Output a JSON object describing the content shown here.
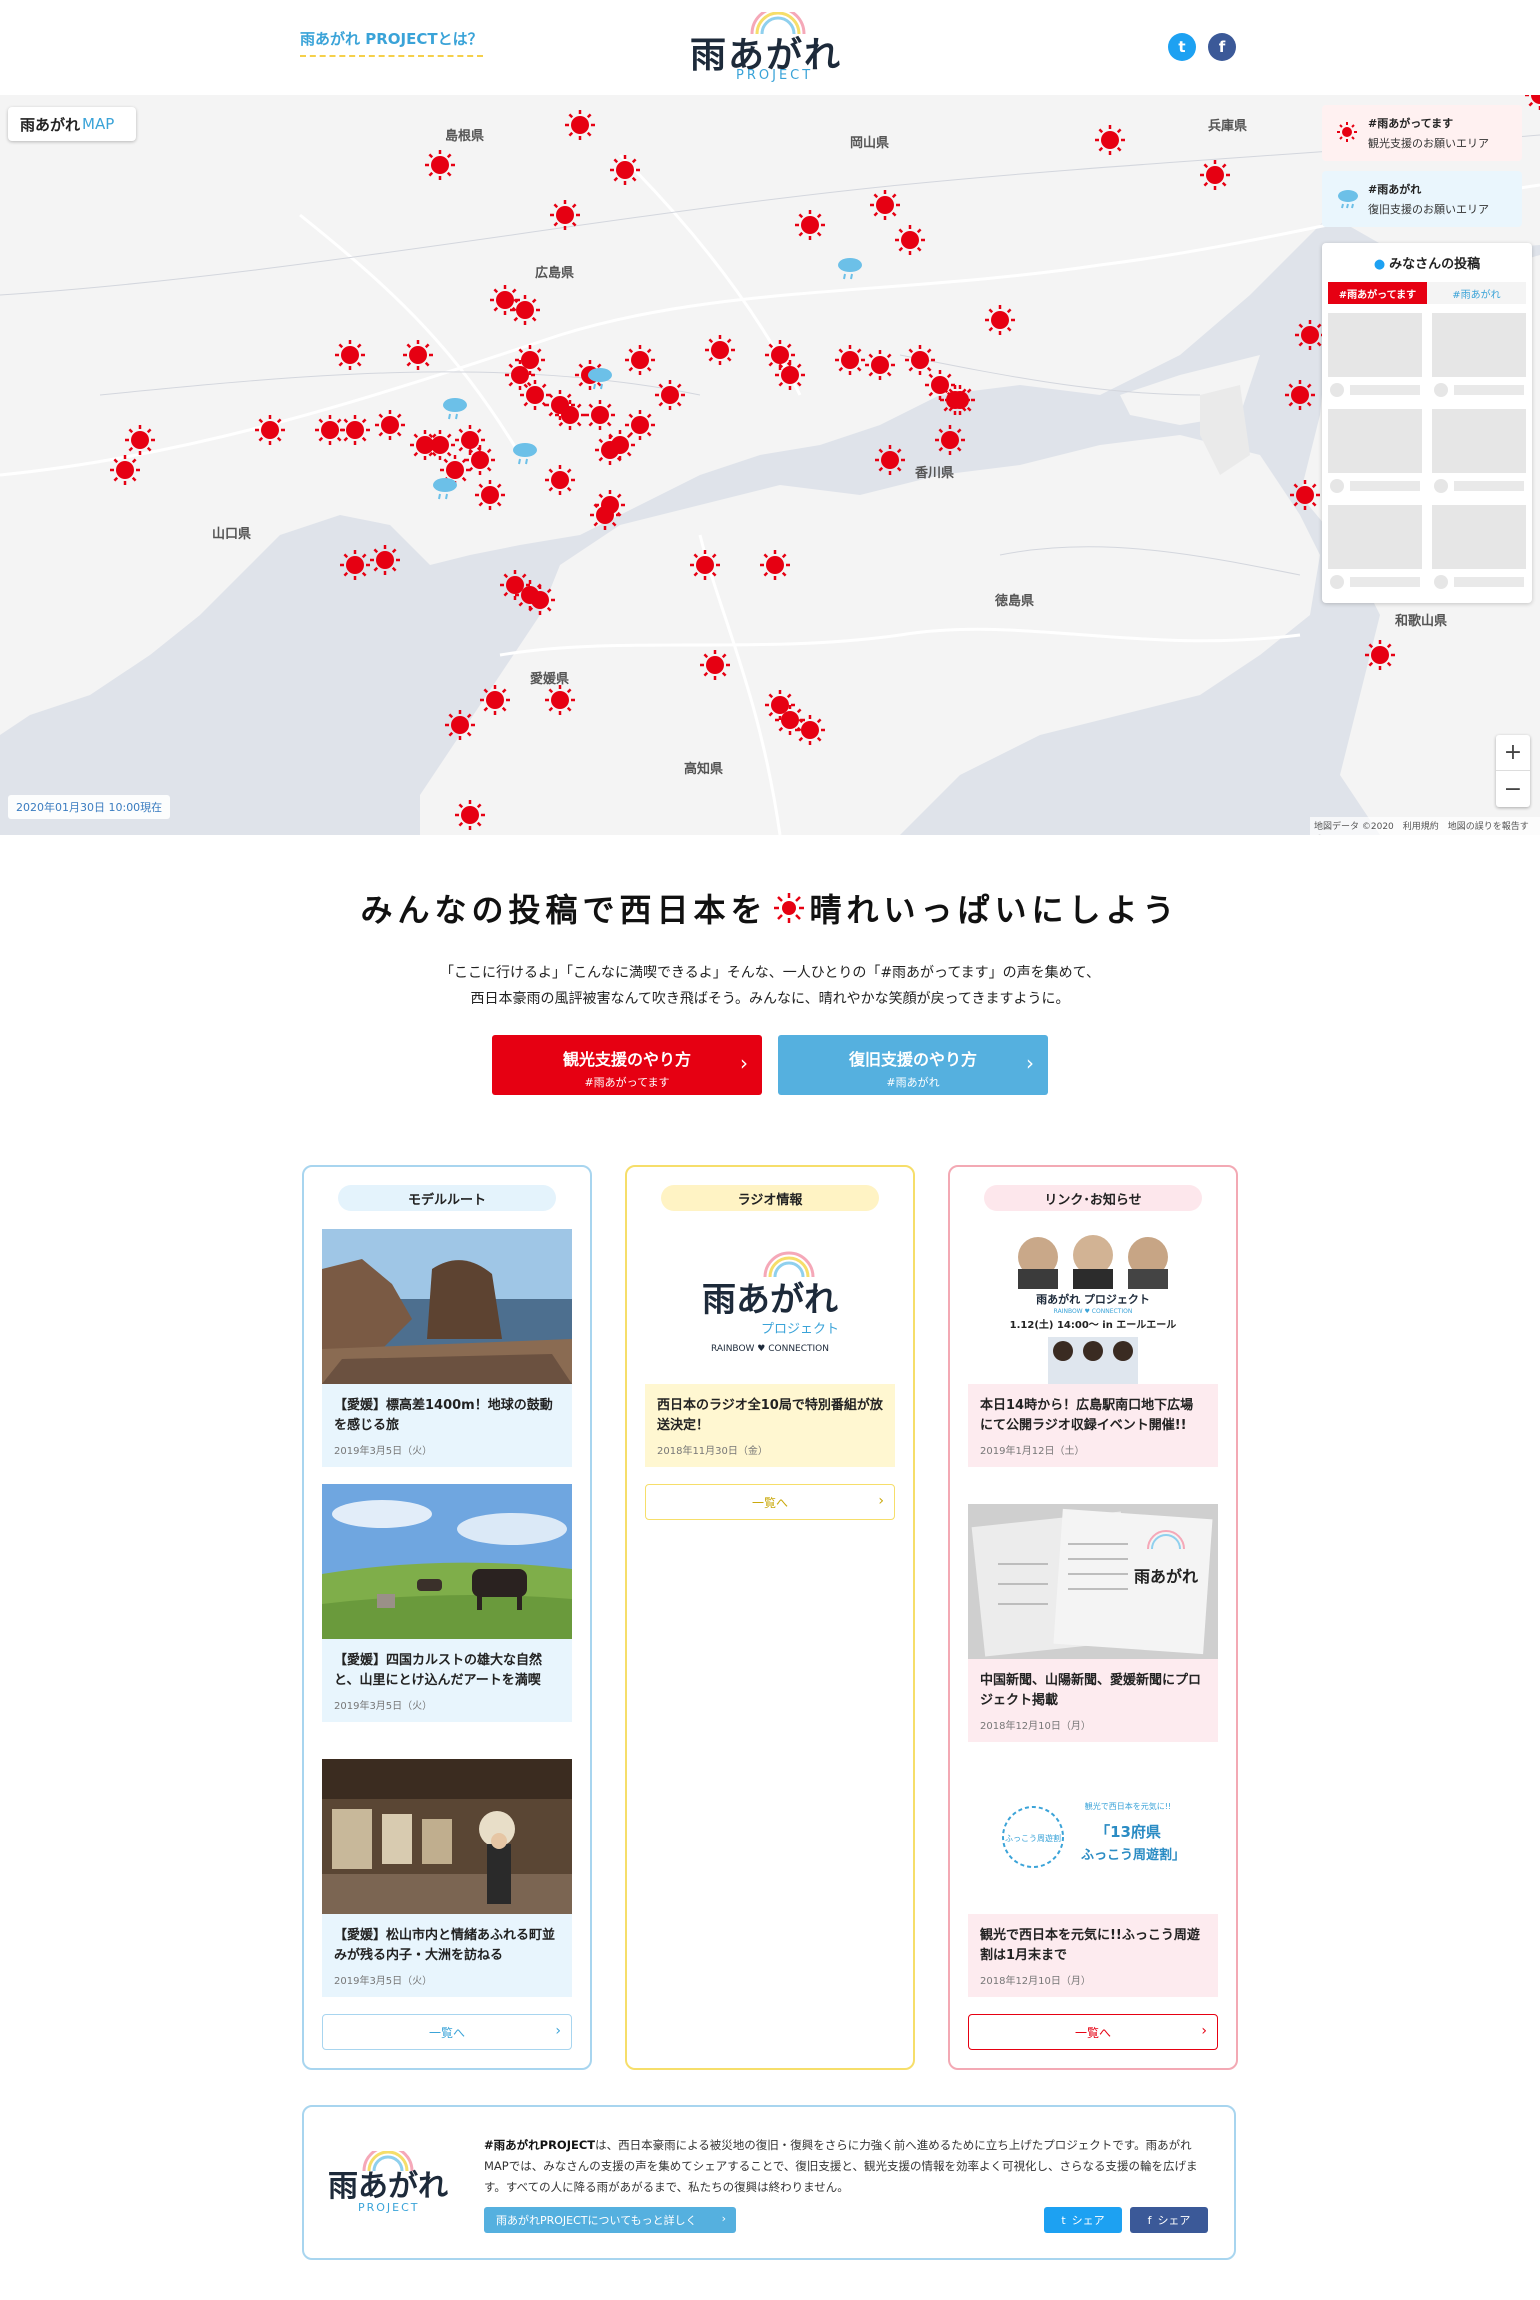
{
  "header": {
    "about_link": "雨あがれ PROJECTとは？",
    "logo_main": "雨あがれ",
    "logo_sub": "PROJECT",
    "twitter_icon": "twitter-icon",
    "facebook_icon": "facebook-icon"
  },
  "map": {
    "badge_main": "雨あがれ",
    "badge_sub": "MAP",
    "date": "2020年01月30日 10:00現在",
    "credit": "地図データ ©2020　利用規約　地図の誤りを報告する",
    "zoom_in": "+",
    "zoom_out": "−",
    "legend_sun_title": "#雨あがってます",
    "legend_sun_desc": "観光支援のお願いエリア",
    "legend_rain_title": "#雨あがれ",
    "legend_rain_desc": "復旧支援のお願いエリア",
    "posts_title": "みなさんの投稿",
    "posts_tab_1": "#雨あがってます",
    "posts_tab_2": "#雨あがれ",
    "prefectures": [
      "島根県",
      "岡山県",
      "兵庫県",
      "広島県",
      "山口県",
      "香川県",
      "徳島県",
      "愛媛県",
      "高知県",
      "和歌山県"
    ],
    "colors": {
      "sun": "#e60012",
      "rain": "#6cc0e8",
      "land": "#f4f4f4",
      "sea": "#dfe3ea"
    }
  },
  "hero": {
    "title_1": "みんなの投稿で西日本を",
    "title_2": "晴れいっぱいにしよう",
    "desc_line1": "「ここに行けるよ」「こんなに満喫できるよ」そんな、一人ひとりの「#雨あがってます」の声を集めて、",
    "desc_line2": "西日本豪雨の風評被害なんて吹き飛ばそう。みんなに、晴れやかな笑顔が戻ってきますように。",
    "cta_tourism_label": "観光支援のやり方",
    "cta_tourism_tag": "#雨あがってます",
    "cta_recovery_label": "復旧支援のやり方",
    "cta_recovery_tag": "#雨あがれ"
  },
  "columns": {
    "model_route": {
      "heading": "モデルルート",
      "cards": [
        {
          "title": "【愛媛】標高差1400m！地球の鼓動を感じる旅",
          "date": "2019年3月5日（火）"
        },
        {
          "title": "【愛媛】四国カルストの雄大な自然と、山里にとけ込んだアートを満喫",
          "date": "2019年3月5日（火）"
        },
        {
          "title": "【愛媛】松山市内と情緒あふれる町並みが残る内子・大洲を訪ねる",
          "date": "2019年3月5日（火）"
        }
      ],
      "more": "一覧へ"
    },
    "radio": {
      "heading": "ラジオ情報",
      "logo_main": "雨あがれ",
      "logo_project": "プロジェクト",
      "logo_sub": "RAINBOW ♥ CONNECTION",
      "cards": [
        {
          "title": "西日本のラジオ全10局で特別番組が放送決定！",
          "date": "2018年11月30日（金）"
        }
      ],
      "more": "一覧へ"
    },
    "news": {
      "heading": "リンク･お知らせ",
      "event_logo": "雨あがれ プロジェクト",
      "event_sub": "RAINBOW ♥ CONNECTION",
      "event_date": "1.12(土) 14:00〜 in エールエール",
      "news_logo": "雨あがれ",
      "fukko_badge": "ふっこう周遊割",
      "fukko_lead": "観光で西日本を元気に!!",
      "fukko_title_1": "「13府県",
      "fukko_title_2": "ふっこう周遊割」",
      "cards": [
        {
          "title": "本日14時から！広島駅南口地下広場にて公開ラジオ収録イベント開催!!",
          "date": "2019年1月12日（土）"
        },
        {
          "title": "中国新聞、山陽新聞、愛媛新聞にプロジェクト掲載",
          "date": "2018年12月10日（月）"
        },
        {
          "title": "観光で西日本を元気に!!ふっこう周遊割は1月末まで",
          "date": "2018年12月10日（月）"
        }
      ],
      "more": "一覧へ"
    }
  },
  "about": {
    "logo_main": "雨あがれ",
    "logo_sub": "PROJECT",
    "text_bold": "#雨あがれPROJECT",
    "text_rest": "は、西日本豪雨による被災地の復旧・復興をさらに力強く前へ進めるために立ち上げたプロジェクトです。雨あがれMAPでは、みなさんの支援の声を集めてシェアすることで、復旧支援と、観光支援の情報を効率よく可視化し、さらなる支援の輪を広げます。すべての人に降る雨があがるまで、私たちの復興は終わりません。",
    "more_button": "雨あがれPROJECTについてもっと詳しく",
    "share_tw": "シェア",
    "share_fb": "シェア"
  }
}
